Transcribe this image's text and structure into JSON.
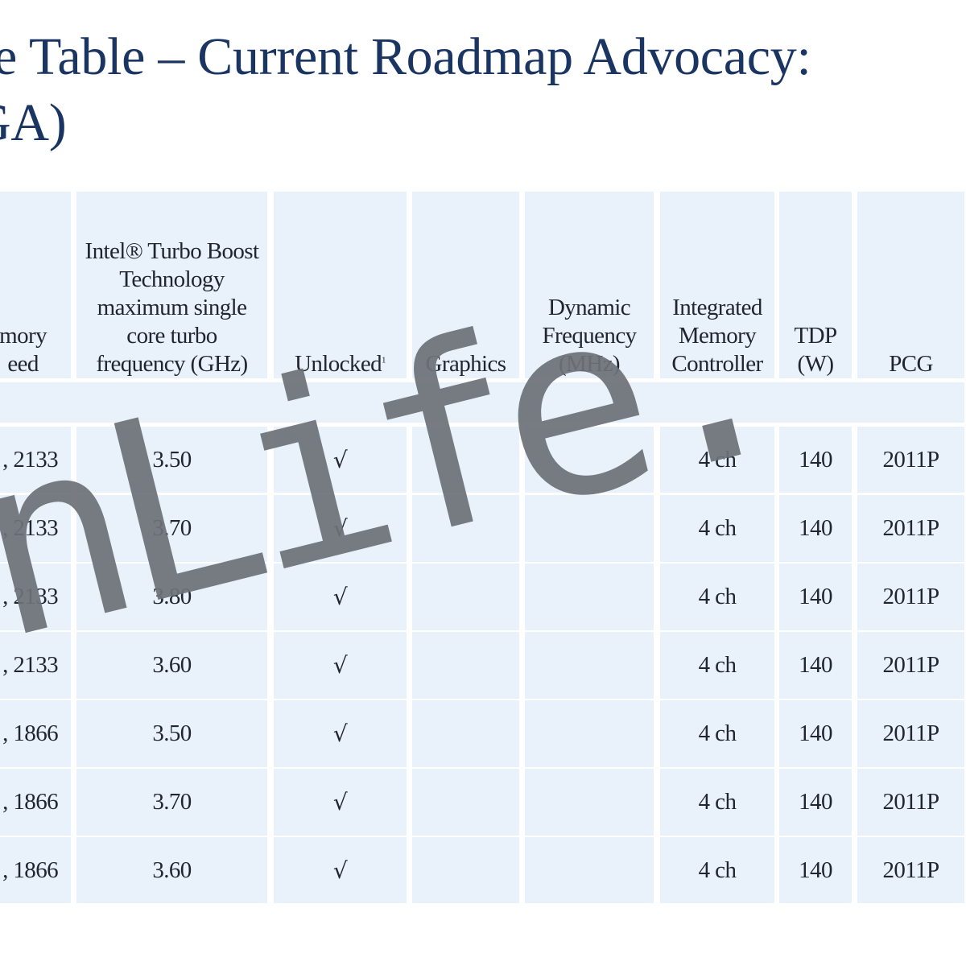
{
  "title": {
    "line1": "e Table – Current Roadmap Advocacy:",
    "line2": "GA)"
  },
  "table": {
    "columns": [
      {
        "key": "memory_speed",
        "label": "mory\need"
      },
      {
        "key": "turbo",
        "label": "Intel® Turbo Boost\nTechnology\nmaximum single\ncore turbo\nfrequency (GHz)"
      },
      {
        "key": "unlocked",
        "label": "Unlocked",
        "sup": "1"
      },
      {
        "key": "graphics",
        "label": "Graphics"
      },
      {
        "key": "dynamic_freq",
        "label": "Dynamic\nFrequency\n(MHz)"
      },
      {
        "key": "imc",
        "label": "Integrated\nMemory\nController"
      },
      {
        "key": "tdp",
        "label": "TDP\n(W)"
      },
      {
        "key": "pcg",
        "label": "PCG"
      }
    ],
    "rows": [
      {
        "memory_speed": ", 2133",
        "turbo": "3.50",
        "unlocked": "√",
        "graphics": "",
        "dynamic_freq": "",
        "imc": "4 ch",
        "tdp": "140",
        "pcg": "2011P"
      },
      {
        "memory_speed": ", 2133",
        "turbo": "3.70",
        "unlocked": "√",
        "graphics": "",
        "dynamic_freq": "",
        "imc": "4 ch",
        "tdp": "140",
        "pcg": "2011P"
      },
      {
        "memory_speed": ", 2133",
        "turbo": "3.80",
        "unlocked": "√",
        "graphics": "",
        "dynamic_freq": "",
        "imc": "4 ch",
        "tdp": "140",
        "pcg": "2011P"
      },
      {
        "memory_speed": ", 2133",
        "turbo": "3.60",
        "unlocked": "√",
        "graphics": "",
        "dynamic_freq": "",
        "imc": "4 ch",
        "tdp": "140",
        "pcg": "2011P"
      },
      {
        "memory_speed": ", 1866",
        "turbo": "3.50",
        "unlocked": "√",
        "graphics": "",
        "dynamic_freq": "",
        "imc": "4 ch",
        "tdp": "140",
        "pcg": "2011P"
      },
      {
        "memory_speed": ", 1866",
        "turbo": "3.70",
        "unlocked": "√",
        "graphics": "",
        "dynamic_freq": "",
        "imc": "4 ch",
        "tdp": "140",
        "pcg": "2011P"
      },
      {
        "memory_speed": ", 1866",
        "turbo": "3.60",
        "unlocked": "√",
        "graphics": "",
        "dynamic_freq": "",
        "imc": "4 ch",
        "tdp": "140",
        "pcg": "2011P"
      }
    ]
  },
  "watermark": {
    "text": "nLife."
  },
  "colors": {
    "title": "#1b3563",
    "cell_bg": "#e9f2fb",
    "text": "#202630",
    "watermark": "#6e7278"
  }
}
